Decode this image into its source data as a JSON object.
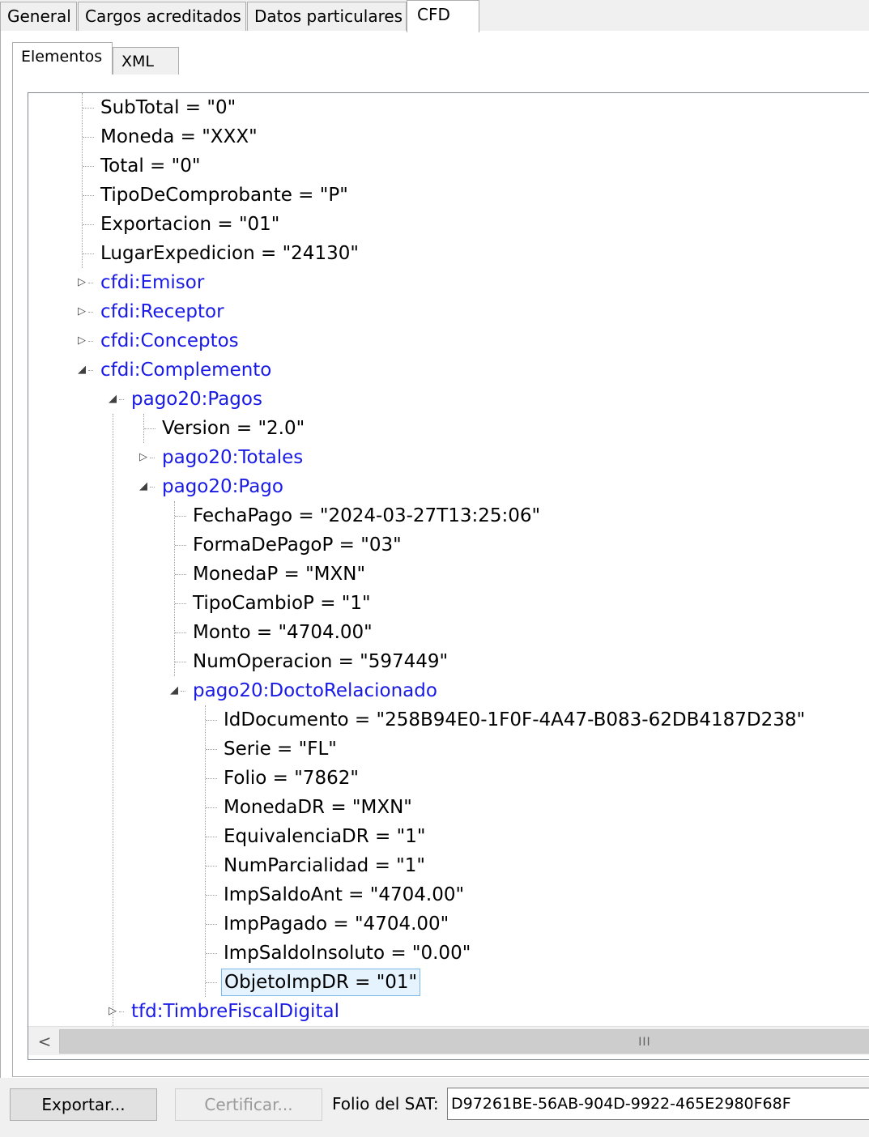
{
  "tabs": {
    "general": "General",
    "cargos": "Cargos acreditados",
    "datos": "Datos particulares",
    "cfd": "CFD",
    "active": "CFD"
  },
  "subtabs": {
    "elementos": "Elementos",
    "xml": "XML",
    "active": "Elementos"
  },
  "tree": [
    {
      "text": "SubTotal = \"0\"",
      "level": 1,
      "type": "attr"
    },
    {
      "text": "Moneda = \"XXX\"",
      "level": 1,
      "type": "attr"
    },
    {
      "text": "Total = \"0\"",
      "level": 1,
      "type": "attr"
    },
    {
      "text": "TipoDeComprobante = \"P\"",
      "level": 1,
      "type": "attr"
    },
    {
      "text": "Exportacion = \"01\"",
      "level": 1,
      "type": "attr"
    },
    {
      "text": "LugarExpedicion = \"24130\"",
      "level": 1,
      "type": "attr"
    },
    {
      "text": "cfdi:Emisor",
      "level": 1,
      "type": "node",
      "state": "collapsed"
    },
    {
      "text": "cfdi:Receptor",
      "level": 1,
      "type": "node",
      "state": "collapsed"
    },
    {
      "text": "cfdi:Conceptos",
      "level": 1,
      "type": "node",
      "state": "collapsed"
    },
    {
      "text": "cfdi:Complemento",
      "level": 1,
      "type": "node",
      "state": "expanded"
    },
    {
      "text": "pago20:Pagos",
      "level": 2,
      "type": "node",
      "state": "expanded"
    },
    {
      "text": "Version = \"2.0\"",
      "level": 3,
      "type": "attr"
    },
    {
      "text": "pago20:Totales",
      "level": 3,
      "type": "node",
      "state": "collapsed"
    },
    {
      "text": "pago20:Pago",
      "level": 3,
      "type": "node",
      "state": "expanded"
    },
    {
      "text": "FechaPago = \"2024-03-27T13:25:06\"",
      "level": 4,
      "type": "attr"
    },
    {
      "text": "FormaDePagoP = \"03\"",
      "level": 4,
      "type": "attr"
    },
    {
      "text": "MonedaP = \"MXN\"",
      "level": 4,
      "type": "attr"
    },
    {
      "text": "TipoCambioP = \"1\"",
      "level": 4,
      "type": "attr"
    },
    {
      "text": "Monto = \"4704.00\"",
      "level": 4,
      "type": "attr"
    },
    {
      "text": "NumOperacion = \"597449\"",
      "level": 4,
      "type": "attr"
    },
    {
      "text": "pago20:DoctoRelacionado",
      "level": 4,
      "type": "node",
      "state": "expanded"
    },
    {
      "text": "IdDocumento = \"258B94E0-1F0F-4A47-B083-62DB4187D238\"",
      "level": 5,
      "type": "attr"
    },
    {
      "text": "Serie = \"FL\"",
      "level": 5,
      "type": "attr"
    },
    {
      "text": "Folio = \"7862\"",
      "level": 5,
      "type": "attr"
    },
    {
      "text": "MonedaDR = \"MXN\"",
      "level": 5,
      "type": "attr"
    },
    {
      "text": "EquivalenciaDR = \"1\"",
      "level": 5,
      "type": "attr"
    },
    {
      "text": "NumParcialidad = \"1\"",
      "level": 5,
      "type": "attr"
    },
    {
      "text": "ImpSaldoAnt = \"4704.00\"",
      "level": 5,
      "type": "attr"
    },
    {
      "text": "ImpPagado = \"4704.00\"",
      "level": 5,
      "type": "attr"
    },
    {
      "text": "ImpSaldoInsoluto = \"0.00\"",
      "level": 5,
      "type": "attr"
    },
    {
      "text": "ObjetoImpDR = \"01\"",
      "level": 5,
      "type": "attr",
      "selected": true
    },
    {
      "text": "tfd:TimbreFiscalDigital",
      "level": 2,
      "type": "node",
      "state": "collapsed"
    }
  ],
  "scrollbar": {
    "left_glyph": "<",
    "grip_glyph": "III"
  },
  "expander_glyphs": {
    "collapsed": "▷",
    "expanded": "◢"
  },
  "buttons": {
    "exportar": "Exportar...",
    "certificar": "Certificar..."
  },
  "folio_sat": {
    "label": "Folio del SAT:",
    "value": "D97261BE-56AB-904D-9922-465E2980F68F"
  },
  "colors": {
    "node_text": "#1a1ae6",
    "selection_bg": "#e5f3ff",
    "selection_border": "#7ab8ee"
  }
}
